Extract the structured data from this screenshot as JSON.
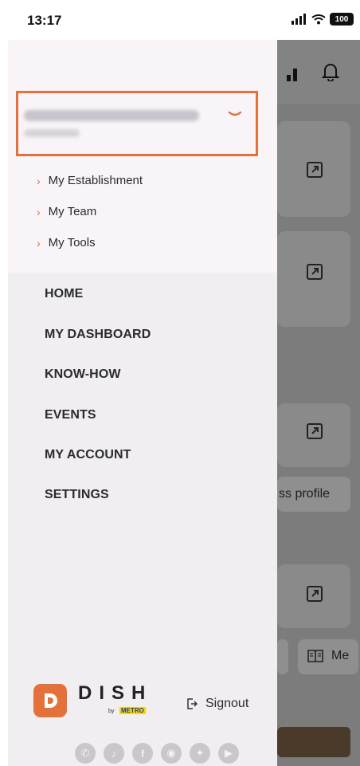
{
  "status_bar": {
    "time": "13:17",
    "battery": "100"
  },
  "establishment": {
    "name": "HEY DE Test Establishment",
    "subtitle": "Germany"
  },
  "sub_menu": [
    {
      "label": "My Establishment"
    },
    {
      "label": "My Team"
    },
    {
      "label": "My Tools"
    }
  ],
  "nav": [
    {
      "label": "HOME"
    },
    {
      "label": "MY DASHBOARD"
    },
    {
      "label": "KNOW-HOW"
    },
    {
      "label": "EVENTS"
    },
    {
      "label": "MY ACCOUNT"
    },
    {
      "label": "SETTINGS"
    }
  ],
  "footer": {
    "logo_word": "DISH",
    "logo_by": "by",
    "logo_metro": "METRO",
    "signout_label": "Signout",
    "socials": [
      "whatsapp-icon",
      "tiktok-icon",
      "facebook-icon",
      "instagram-icon",
      "twitter-icon",
      "youtube-icon"
    ]
  },
  "background": {
    "partial_text_1": "ss profile",
    "partial_text_2": "Me"
  },
  "colors": {
    "accent": "#e4703a",
    "drawer_bg": "#f0eef1",
    "drawer_top_bg": "#f9f4f8",
    "overlay": "#7c7c7c"
  }
}
